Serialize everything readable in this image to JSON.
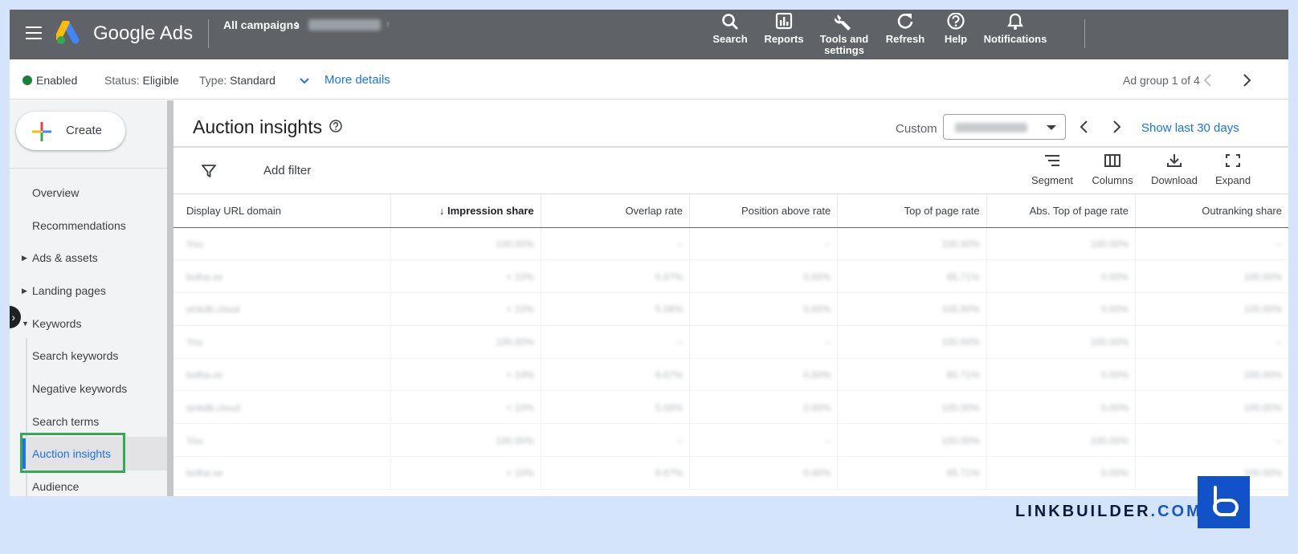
{
  "topbar": {
    "brand": "Google Ads",
    "breadcrumb": "All campaigns",
    "tools": [
      {
        "label": "Search",
        "icon": "search-icon"
      },
      {
        "label": "Reports",
        "icon": "reports-icon"
      },
      {
        "label": "Tools and settings",
        "icon": "wrench-icon"
      },
      {
        "label": "Refresh",
        "icon": "refresh-icon"
      },
      {
        "label": "Help",
        "icon": "help-icon"
      },
      {
        "label": "Notifications",
        "icon": "bell-icon"
      }
    ]
  },
  "statusbar": {
    "enabled": "Enabled",
    "status_label": "Status:",
    "status_value": "Eligible",
    "type_label": "Type:",
    "type_value": "Standard",
    "more_details": "More details",
    "ad_group": "Ad group 1 of 4"
  },
  "sidebar": {
    "create": "Create",
    "items": [
      {
        "label": "Overview"
      },
      {
        "label": "Recommendations"
      },
      {
        "label": "Ads & assets"
      },
      {
        "label": "Landing pages"
      },
      {
        "label": "Keywords"
      },
      {
        "label": "Search keywords"
      },
      {
        "label": "Negative keywords"
      },
      {
        "label": "Search terms"
      },
      {
        "label": "Auction insights"
      },
      {
        "label": "Audience"
      }
    ]
  },
  "main": {
    "title": "Auction insights",
    "date_mode": "Custom",
    "show_last": "Show last 30 days",
    "add_filter": "Add filter",
    "toolbar": {
      "segment": "Segment",
      "columns": "Columns",
      "download": "Download",
      "expand": "Expand"
    },
    "table": {
      "columns": [
        "Display URL domain",
        "Impression share",
        "Overlap rate",
        "Position above rate",
        "Top of page rate",
        "Abs. Top of page rate",
        "Outranking share"
      ]
    }
  },
  "footer": {
    "brand_main": "LINKBUILDER",
    "brand_tld": ".COM"
  },
  "colors": {
    "topbar": "#5f6368",
    "accent": "#1a73e8",
    "enabled_dot": "#188038",
    "highlight": "#34a853",
    "page_bg": "#d4e5fb",
    "brand_logo": "#1252c8"
  }
}
